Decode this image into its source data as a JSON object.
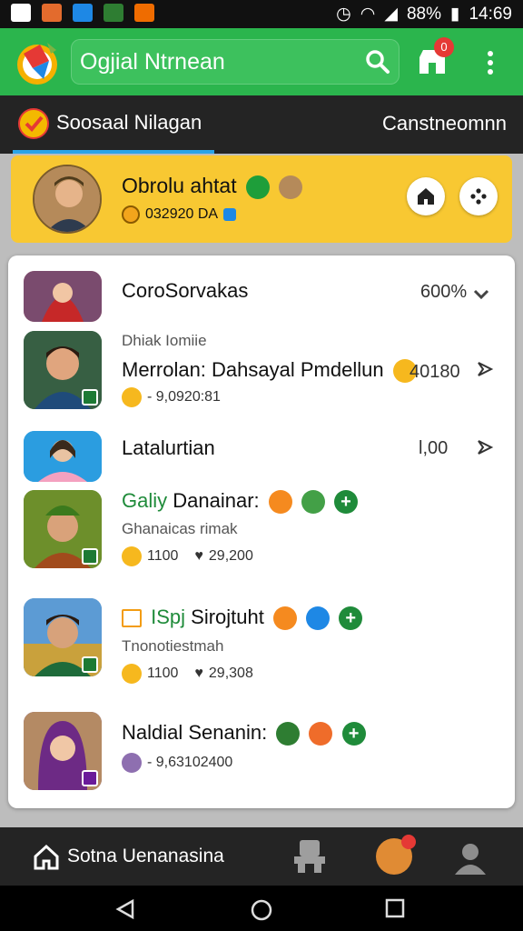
{
  "status_bar": {
    "battery": "88%",
    "time": "14:69"
  },
  "app_bar": {
    "title": "Ogjial Ntrnean",
    "store_badge": "0"
  },
  "tabs": {
    "active": "Soosaal Nilagan",
    "other": "Canstneomnn"
  },
  "profile": {
    "name": "Obrolu ahtat",
    "id": "032920 DA"
  },
  "list": [
    {
      "title": "CoroSorvakas",
      "right": "600%"
    },
    {
      "kicker": "Dhiak Iomiie",
      "title": "Merrolan: Dahsayal Pmdellun",
      "right": "40180",
      "meta": "- 9,0920:81"
    },
    {
      "title": "Latalurtian",
      "right": "Ɩ,00"
    },
    {
      "title_prefix": "Galiy",
      "title": "Danainar:",
      "sub": "Ghanaicas rimak",
      "meta_a": "1100",
      "meta_b": "29,200"
    },
    {
      "title_prefix": "ISpj",
      "title": "Sirojtuht",
      "sub": "Tnonotiestmah",
      "meta_a": "1100",
      "meta_b": "29,308"
    },
    {
      "title": "Naldial Senanin:",
      "meta": "- 9,63102400"
    }
  ],
  "bottom_nav": {
    "label": "Sotna Uenanasina"
  }
}
